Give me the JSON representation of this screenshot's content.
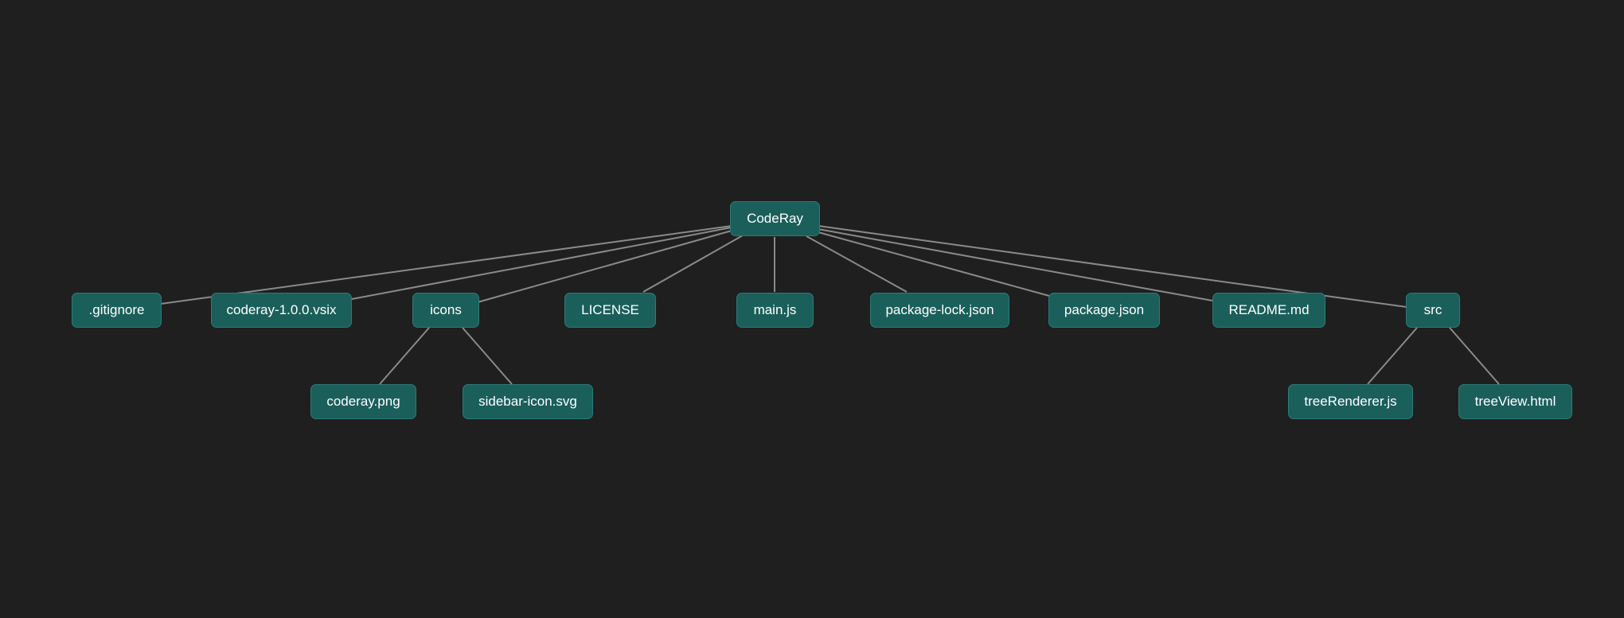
{
  "tree": {
    "root": {
      "id": "root",
      "label": "CodeRay"
    },
    "children": [
      {
        "id": "gitignore",
        "label": ".gitignore"
      },
      {
        "id": "vsix",
        "label": "coderay-1.0.0.vsix"
      },
      {
        "id": "icons",
        "label": "icons",
        "children": [
          {
            "id": "coderay-png",
            "label": "coderay.png"
          },
          {
            "id": "sidebar-icon",
            "label": "sidebar-icon.svg"
          }
        ]
      },
      {
        "id": "license",
        "label": "LICENSE"
      },
      {
        "id": "mainjs",
        "label": "main.js"
      },
      {
        "id": "pkglock",
        "label": "package-lock.json"
      },
      {
        "id": "pkg",
        "label": "package.json"
      },
      {
        "id": "readme",
        "label": "README.md"
      },
      {
        "id": "src",
        "label": "src",
        "children": [
          {
            "id": "treerenderer",
            "label": "treeRenderer.js"
          },
          {
            "id": "treeview",
            "label": "treeView.html"
          }
        ]
      }
    ]
  },
  "colors": {
    "background": "#1f1f1f",
    "node_fill": "#1b5f5b",
    "node_border": "#2d7a75",
    "edge": "#8a8a8a",
    "text": "#ffffff"
  }
}
